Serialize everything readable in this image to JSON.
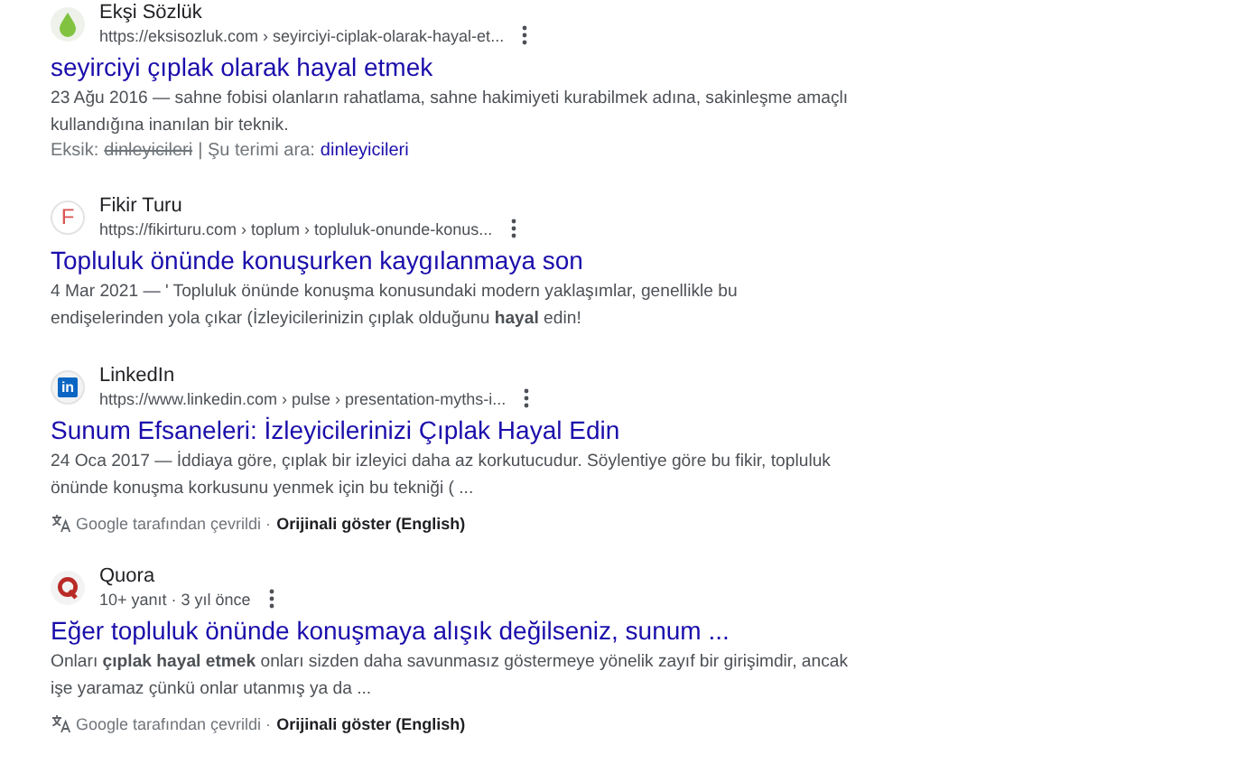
{
  "results": [
    {
      "favicon": {
        "kind": "drop"
      },
      "site": "Ekşi Sözlük",
      "url": "https://eksisozluk.com › seyirciyi-ciplak-olarak-hayal-et...",
      "title": "seyirciyi çıplak olarak hayal etmek",
      "snippet": "23 Ağu 2016 — sahne fobisi olanların rahatlama, sahne hakimiyeti kurabilmek adına, sakinleşme amaçlı kullandığına inanılan bir teknik.",
      "missing": {
        "label": "Eksik:",
        "term": "dinleyicileri",
        "search_label": "| Şu terimi ara:",
        "search_term": "dinleyicileri"
      }
    },
    {
      "favicon": {
        "kind": "letter",
        "text": "F"
      },
      "site": "Fikir Turu",
      "url": "https://fikirturu.com › toplum › topluluk-onunde-konus...",
      "title": "Topluluk önünde konuşurken kaygılanmaya son",
      "snippet": "4 Mar 2021 — ' Topluluk önünde konuşma konusundaki modern yaklaşımlar, genellikle bu endişelerinden yola çıkar (İzleyicilerinizin çıplak olduğunu **hayal** edin!"
    },
    {
      "favicon": {
        "kind": "square",
        "text": "in"
      },
      "site": "LinkedIn",
      "url": "https://www.linkedin.com › pulse › presentation-myths-i...",
      "title": "Sunum Efsaneleri: İzleyicilerinizi Çıplak Hayal Edin",
      "snippet": "24 Oca 2017 — İddiaya göre, çıplak bir izleyici daha az korkutucudur. Söylentiye göre bu fikir, topluluk önünde konuşma korkusunu yenmek için bu tekniği ( ...",
      "translation": {
        "note": "Google tarafından çevrildi ·",
        "link": "Orijinali göster (English)"
      }
    },
    {
      "favicon": {
        "kind": "ring"
      },
      "site": "Quora",
      "url": "10+ yanıt · 3 yıl önce",
      "title": "Eğer topluluk önünde konuşmaya alışık değilseniz, sunum ...",
      "snippet": "Onları **çıplak hayal etmek** onları sizden daha savunmasız göstermeye yönelik zayıf bir girişimdir, ancak işe yaramaz çünkü onlar utanmış ya da ...",
      "translation": {
        "note": "Google tarafından çevrildi ·",
        "link": "Orijinali göster (English)"
      }
    }
  ]
}
